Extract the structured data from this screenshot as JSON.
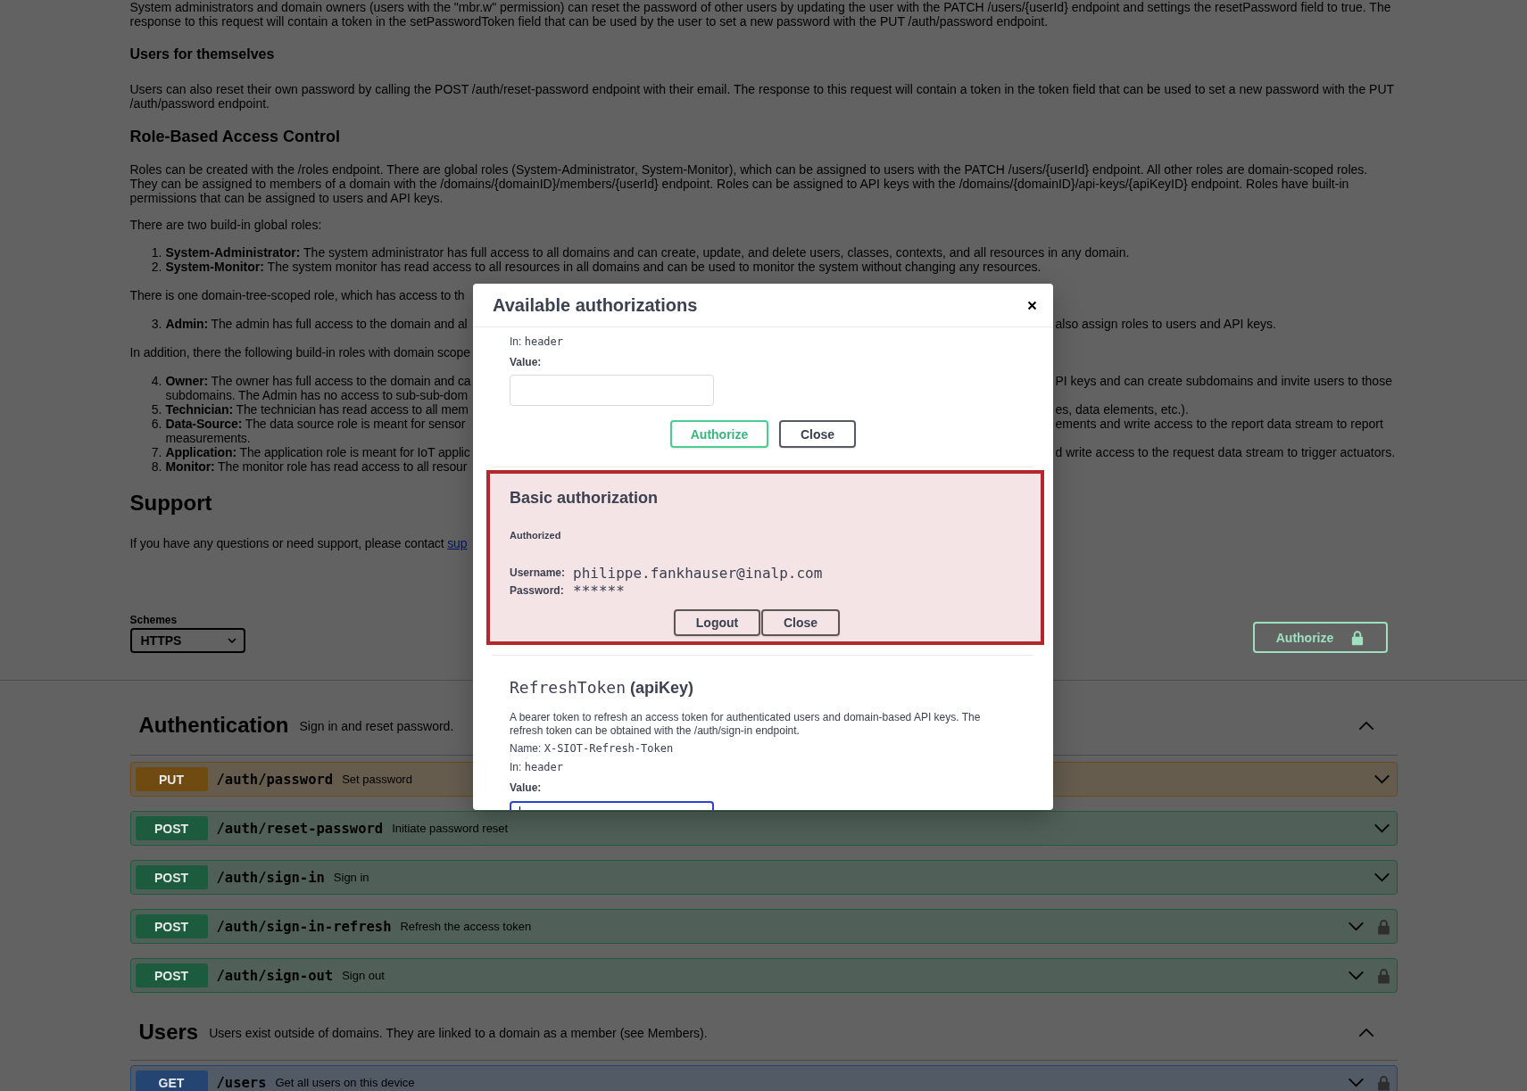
{
  "docs": [
    {
      "kind": "paragraph",
      "text": "System administrators and domain owners (users with the \"mbr.w\" permission) can reset the password of other users by updating the user with the PATCH /users/{userId} endpoint and settings the resetPassword field to true. The response to this request will contain a token in the setPasswordToken field that can be used by the user to set a new password with the PUT /auth/password endpoint."
    },
    {
      "kind": "subheading",
      "text": "Users for themselves"
    },
    {
      "kind": "paragraph",
      "text": "Users can also reset their own password by calling the POST /auth/reset-password endpoint with their email. The response to this request will contain a token in the token field that can be used to set a new password with the PUT /auth/password endpoint."
    },
    {
      "kind": "heading",
      "text": "Role-Based Access Control"
    },
    {
      "kind": "paragraph",
      "text": "Roles can be created with the /roles endpoint. There are global roles (System-Administrator, System-Monitor), which can be assigned to users with the PATCH /users/{userId} endpoint. All other roles are domain-scoped roles. They can be assigned to members of a domain with the /domains/{domainID}/members/{userId} endpoint. Roles can be assigned to API keys with the /domains/{domainID}/api-keys/{apiKeyID} endpoint. Roles have built-in permissions that can be assigned to users and API keys."
    },
    {
      "kind": "paragraph",
      "text": "There are two build-in global roles:"
    },
    {
      "kind": "list",
      "items": [
        {
          "number": "1.",
          "text": "**System-Administrator:** The system administrator has full access to all domains and can create, update, and delete users, classes, contexts, and all resources in any domain."
        },
        {
          "number": "2.",
          "text": "**System-Monitor:** The system monitor has read access to all resources in all domains and can be used to monitor the system without changing any resources."
        }
      ]
    },
    {
      "kind": "covered_paragraph",
      "lines": [
        {
          "left": "There is one domain-tree-scoped role, which has access to th"
        }
      ]
    },
    {
      "kind": "covered_list",
      "items": [
        {
          "number": "3.",
          "lines": [
            {
              "left": "**Admin:** The admin has full access to the domain and al",
              "right": "also assign roles to users and API keys."
            }
          ]
        }
      ]
    },
    {
      "kind": "covered_paragraph",
      "lines": [
        {
          "left": "In addition, there the following build-in roles with domain scope"
        }
      ]
    },
    {
      "kind": "covered_list",
      "items": [
        {
          "number": "4.",
          "lines": [
            {
              "left": "**Owner:** The owner has full access to the domain and ca",
              "right": "PI keys and can create subdomains and invite users to those"
            },
            {
              "left": "subdomains. The Admin has no access to sub-sub-dom"
            }
          ]
        },
        {
          "number": "5.",
          "lines": [
            {
              "left": "**Technician:** The technician has read access to all mem",
              "right": "es, data elements, etc.)."
            }
          ]
        },
        {
          "number": "6.",
          "lines": [
            {
              "left": "**Data-Source:** The data source role is meant for sensor",
              "right": "ements and write access to the report data stream to report"
            },
            {
              "left": "measurements."
            }
          ]
        },
        {
          "number": "7.",
          "lines": [
            {
              "left": "**Application:** The application role is meant for IoT applic",
              "right": "d write access to the request data stream to trigger actuators."
            }
          ]
        },
        {
          "number": "8.",
          "lines": [
            {
              "left": "**Monitor:** The monitor role has read access to all resour"
            }
          ]
        }
      ]
    },
    {
      "kind": "title",
      "text": "Support"
    },
    {
      "kind": "covered_paragraph",
      "lines": [
        {
          "left": "If you have any questions or need support, please contact ",
          "link": "sup"
        }
      ]
    }
  ],
  "schemes_bar": {
    "label": "Schemes",
    "selected_scheme": "HTTPS",
    "authorize_button": "Authorize"
  },
  "sections": [
    {
      "name": "Authentication",
      "description": "Sign in and reset password.",
      "expanded": true,
      "operations": [
        {
          "method": "PUT",
          "color": "#6f4b12",
          "path": "/auth/password",
          "summary": "Set password",
          "secured": false
        },
        {
          "method": "POST",
          "color": "#1d5b3e",
          "path": "/auth/reset-password",
          "summary": "Initiate password reset",
          "secured": false
        },
        {
          "method": "POST",
          "color": "#1d5b3e",
          "path": "/auth/sign-in",
          "summary": "Sign in",
          "secured": false
        },
        {
          "method": "POST",
          "color": "#1d5b3e",
          "path": "/auth/sign-in-refresh",
          "summary": "Refresh the access token",
          "secured": true
        },
        {
          "method": "POST",
          "color": "#1d5b3e",
          "path": "/auth/sign-out",
          "summary": "Sign out",
          "secured": true
        }
      ]
    },
    {
      "name": "Users",
      "description": "Users exist outside of domains. They are linked to a domain as a member (see Members).",
      "expanded": true,
      "operations": [
        {
          "method": "GET",
          "color": "#244472",
          "path": "/users",
          "summary": "Get all users on this device",
          "secured": true
        }
      ]
    }
  ],
  "modal": {
    "title": "Available authorizations",
    "schemes": [
      {
        "kind": "apikey",
        "location_label": "In:",
        "location": "header",
        "value_label": "Value:",
        "field_focused": false,
        "buttons": [
          {
            "kind": "authorize",
            "label": "Authorize"
          },
          {
            "kind": "close",
            "label": "Close"
          }
        ]
      },
      {
        "kind": "basic",
        "highlighted": true,
        "title": "Basic authorization",
        "status": "Authorized",
        "username_label": "Username:",
        "username": "philippe.fankhauser@inalp.com",
        "password_label": "Password:",
        "password": "******",
        "buttons": [
          {
            "kind": "logout",
            "label": "Logout"
          },
          {
            "kind": "close",
            "label": "Close"
          }
        ]
      },
      {
        "kind": "apikey",
        "name": "RefreshToken",
        "type": "(apiKey)",
        "description": "A bearer token to refresh an access token for authenticated users and domain-based API keys. The refresh token can be obtained with the /auth/sign-in endpoint.",
        "name_label": "Name:",
        "header_name": "X-SIOT-Refresh-Token",
        "location_label": "In:",
        "location": "header",
        "value_label": "Value:",
        "field_focused": true
      }
    ]
  }
}
